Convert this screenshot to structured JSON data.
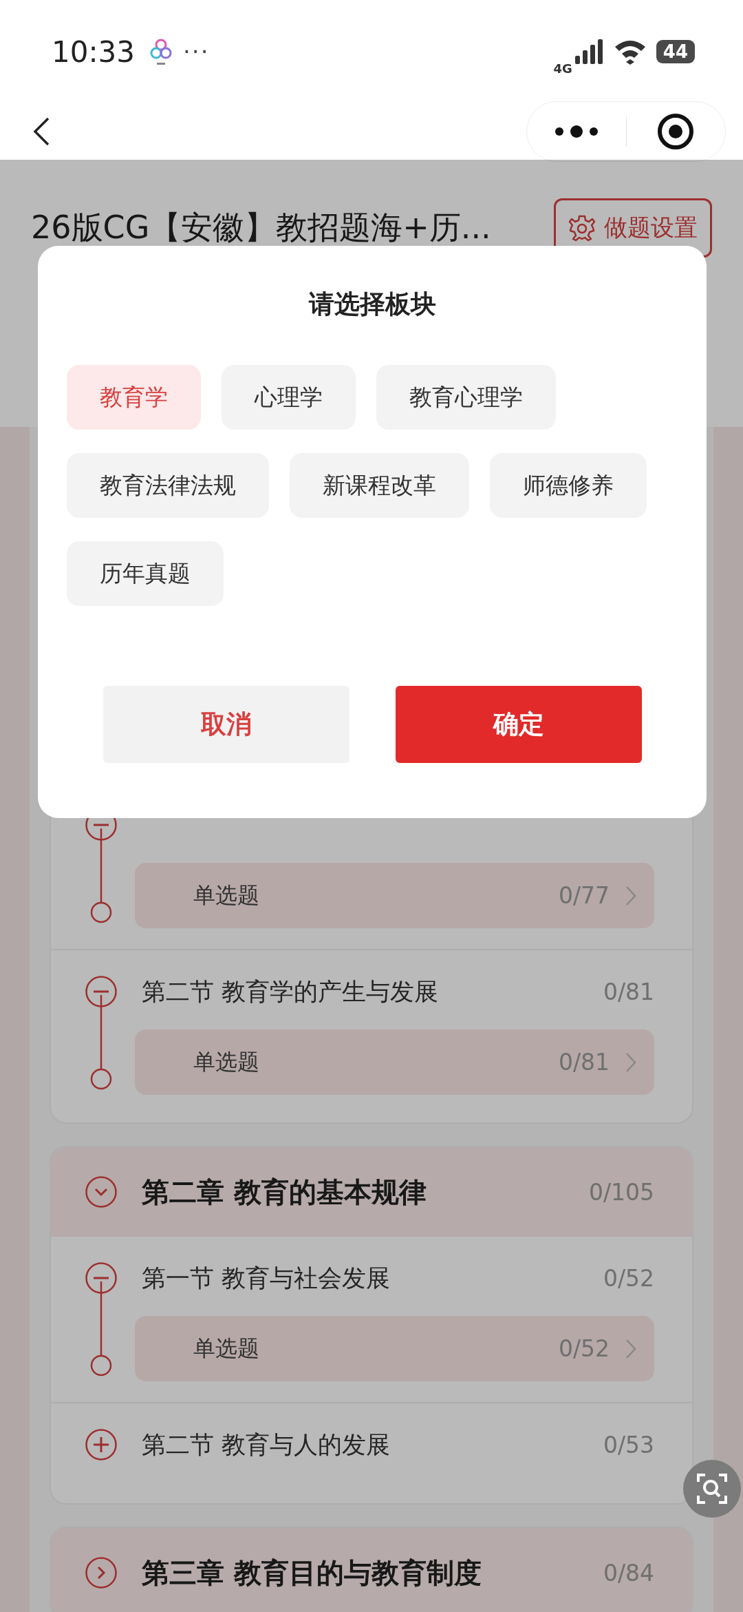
{
  "status_bar": {
    "time": "10:33",
    "more": "···",
    "network": "4G",
    "battery": "44"
  },
  "header": {
    "title": "26版CG【安徽】教招题海+历...",
    "settings_button": "做题设置"
  },
  "chapters": [
    {
      "sections": [
        {
          "expanded": true,
          "items": [
            {
              "label": "单选题",
              "count": "0/77"
            }
          ]
        },
        {
          "title": "第二节 教育学的产生与发展",
          "count": "0/81",
          "expanded": true,
          "items": [
            {
              "label": "单选题",
              "count": "0/81"
            }
          ]
        }
      ]
    },
    {
      "title": "第二章 教育的基本规律",
      "count": "0/105",
      "expanded": true,
      "sections": [
        {
          "title": "第一节 教育与社会发展",
          "count": "0/52",
          "expanded": true,
          "items": [
            {
              "label": "单选题",
              "count": "0/52"
            }
          ]
        },
        {
          "title": "第二节 教育与人的发展",
          "count": "0/53",
          "expanded": false
        }
      ]
    },
    {
      "title": "第三章 教育目的与教育制度",
      "count": "0/84",
      "expanded": false
    }
  ],
  "dialog": {
    "title": "请选择板块",
    "options": [
      {
        "label": "教育学",
        "selected": true
      },
      {
        "label": "心理学",
        "selected": false
      },
      {
        "label": "教育心理学",
        "selected": false
      },
      {
        "label": "教育法律法规",
        "selected": false
      },
      {
        "label": "新课程改革",
        "selected": false
      },
      {
        "label": "师德修养",
        "selected": false
      },
      {
        "label": "历年真题",
        "selected": false
      }
    ],
    "cancel": "取消",
    "confirm": "确定"
  }
}
